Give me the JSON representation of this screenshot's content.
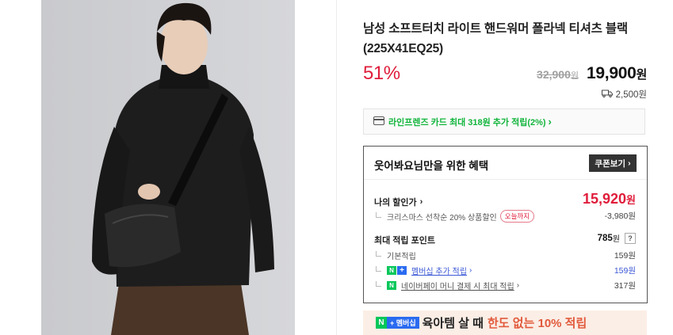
{
  "product": {
    "title": "남성 소프트터치 라이트 핸드워머 폴라넥 티셔츠 블랙 (225X41EQ25)",
    "discount": "51%",
    "original_price": "32,900",
    "price": "19,900",
    "currency": "원",
    "shipping_fee": "2,500원"
  },
  "card_promo": {
    "label": "라인프렌즈 카드 최대 318원 추가 적립(2%)",
    "chevron": "›"
  },
  "benefit": {
    "title": "웃어봐요님만을 위한 혜택",
    "coupon_button": "쿠폰보기",
    "my_discount": {
      "label": "나의 할인가",
      "price": "15,920",
      "currency": "원",
      "sub_label": "크리스마스 선착순 20% 상품할인",
      "sub_badge": "오늘까지",
      "sub_value": "-3,980원"
    },
    "points": {
      "label": "최대 적립 포인트",
      "total": "785",
      "currency": "원",
      "help": "?",
      "rows": [
        {
          "label": "기본적립",
          "value": "159원"
        },
        {
          "label": "멤버십 추가 적립",
          "value": "159원"
        },
        {
          "label": "네이버페이 머니 결제 시 최대 적립",
          "value": "317원"
        }
      ]
    }
  },
  "banner": {
    "badge_n": "N",
    "badge_plus": "+ 멤버십",
    "text": "육아템 살 때",
    "highlight": "한도 없는 10% 적립"
  },
  "colors": {
    "accent_red": "#e01d3b",
    "naver_green": "#03c75a",
    "membership_blue": "#2a6bf0"
  },
  "icons": [
    "card-icon",
    "truck-icon",
    "chevron-right-icon"
  ]
}
